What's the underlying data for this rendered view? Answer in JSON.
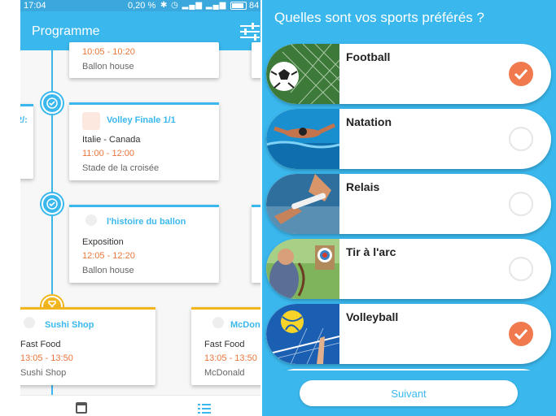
{
  "status_bar": {
    "time": "17:04",
    "signal_percent": "0,20 %",
    "battery": "84"
  },
  "schedule_screen": {
    "title": "Programme",
    "cards": [
      {
        "time": "10:05 - 10:20",
        "place": "Ballon house"
      },
      {
        "title": "Volley Finale 1/1",
        "line": "Italie - Canada",
        "time": "11:00 - 12:00",
        "place": "Stade de la croisée"
      },
      {
        "title": "l'histoire du ballon",
        "line": "Exposition",
        "time": "12:05 - 12:20",
        "place": "Ballon house"
      },
      {
        "title": "Sushi Shop",
        "line": "Fast Food",
        "time": "13:05 - 13:50",
        "place": "Sushi Shop"
      },
      {
        "title": "McDon",
        "line": "Fast Food",
        "time": "13:05 - 13:50",
        "place": "McDonald"
      }
    ],
    "partial_left_card_text": "2/:",
    "colors": {
      "accent": "#3ab8ee",
      "time": "#e8763c",
      "pending": "#f2b51e"
    },
    "node_icons": [
      "check-circle-icon",
      "check-circle-icon",
      "hourglass-icon"
    ],
    "bottom_nav_icons": [
      "calendar-icon",
      "list-icon"
    ]
  },
  "sports_screen": {
    "question": "Quelles sont vos sports préférés ?",
    "sports": [
      {
        "name": "Football",
        "selected": true
      },
      {
        "name": "Natation",
        "selected": false
      },
      {
        "name": "Relais",
        "selected": false
      },
      {
        "name": "Tir à l'arc",
        "selected": false
      },
      {
        "name": "Volleyball",
        "selected": true
      }
    ],
    "next_button": "Suivant",
    "colors": {
      "background": "#3ab8ee",
      "selected": "#f07a4e"
    }
  }
}
